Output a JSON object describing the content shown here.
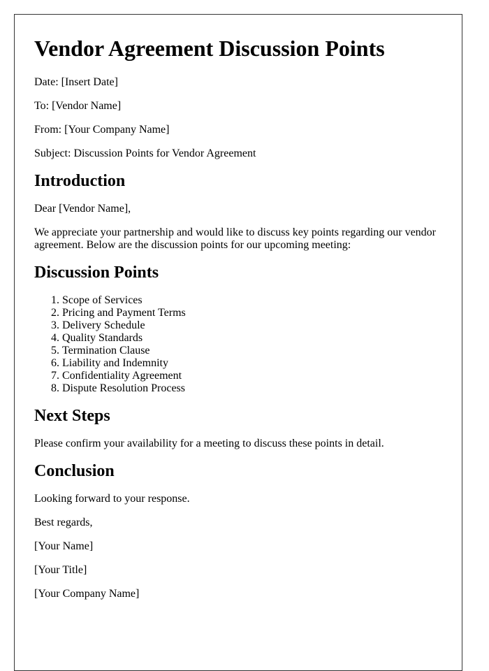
{
  "document": {
    "title": "Vendor Agreement Discussion Points",
    "header_fields": {
      "date": "Date: [Insert Date]",
      "to": "To: [Vendor Name]",
      "from": "From: [Your Company Name]",
      "subject": "Subject: Discussion Points for Vendor Agreement"
    },
    "introduction": {
      "heading": "Introduction",
      "salutation": "Dear [Vendor Name],",
      "body": "We appreciate your partnership and would like to discuss key points regarding our vendor agreement. Below are the discussion points for our upcoming meeting:"
    },
    "discussion_points": {
      "heading": "Discussion Points",
      "items": [
        "Scope of Services",
        "Pricing and Payment Terms",
        "Delivery Schedule",
        "Quality Standards",
        "Termination Clause",
        "Liability and Indemnity",
        "Confidentiality Agreement",
        "Dispute Resolution Process"
      ]
    },
    "next_steps": {
      "heading": "Next Steps",
      "body": "Please confirm your availability for a meeting to discuss these points in detail."
    },
    "conclusion": {
      "heading": "Conclusion",
      "body": "Looking forward to your response.",
      "closing": "Best regards,",
      "signature_name": "[Your Name]",
      "signature_title": "[Your Title]",
      "signature_company": "[Your Company Name]"
    }
  }
}
